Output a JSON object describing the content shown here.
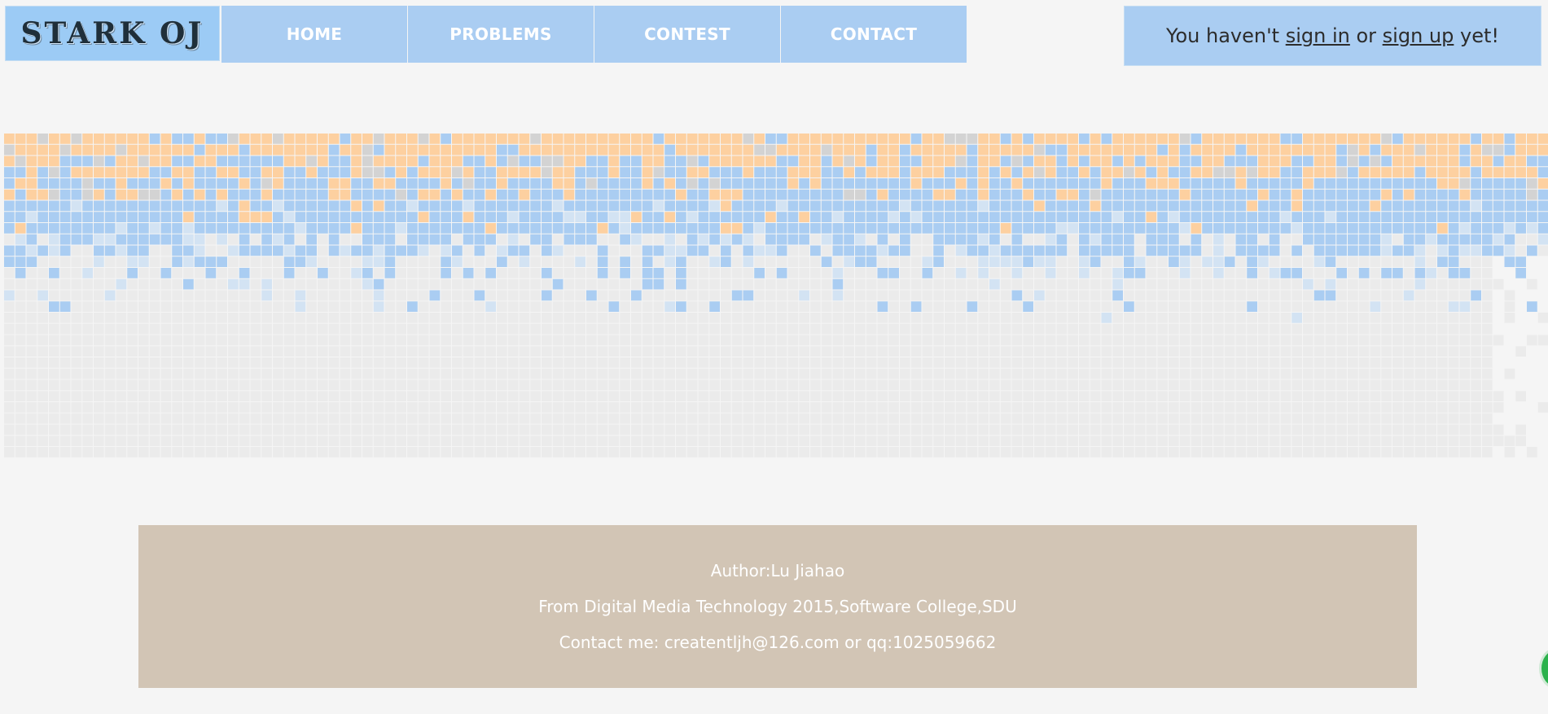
{
  "logo": {
    "text": "STARK OJ"
  },
  "nav": [
    {
      "label": "HOME"
    },
    {
      "label": "PROBLEMS"
    },
    {
      "label": "CONTEST"
    },
    {
      "label": "CONTACT"
    }
  ],
  "auth": {
    "prefix": "You haven't ",
    "sign_in": "sign in",
    "middle": " or ",
    "sign_up": "sign up",
    "suffix": " yet!"
  },
  "footer": {
    "author": "Author:Lu Jiahao",
    "from": "From Digital Media Technology 2015,Software College,SDU",
    "contact": "Contact me: createntljh@126.com or qq:1025059662"
  },
  "colors": {
    "background": "#f5f5f5",
    "nav": "#aacdf2",
    "logo": "#9ccbf5",
    "cell_orange": "#fdd0a0",
    "cell_blue": "#aacdf2",
    "cell_light_blue": "#d3e3f3",
    "cell_grey": "#d3d3d3",
    "cell_empty": "#ebebeb",
    "footer": "#d2c5b5"
  }
}
